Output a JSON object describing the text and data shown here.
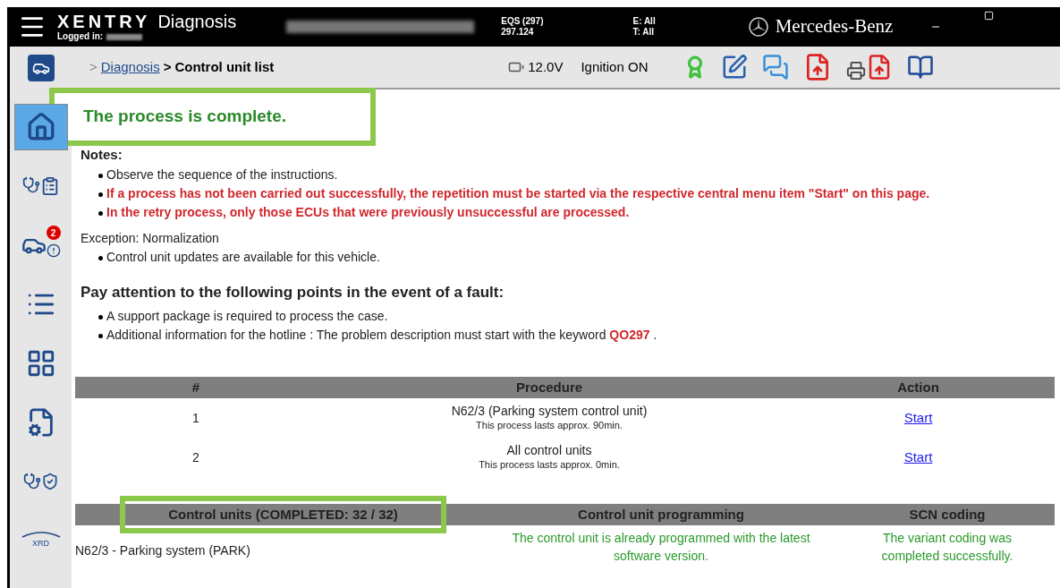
{
  "header": {
    "app_name": "XENTRY",
    "app_subtitle": "Diagnosis",
    "logged_in_label": "Logged in:",
    "vehicle_model": "EQS (297)",
    "vehicle_code": "297.124",
    "filter_e": "E: All",
    "filter_t": "T: All",
    "brand": "Mercedes-Benz"
  },
  "breadcrumb": {
    "separator": ">",
    "items": [
      "Diagnosis",
      "Control unit list"
    ],
    "voltage": "12.0V",
    "ignition": "Ignition ON"
  },
  "sidebar": {
    "items": [
      {
        "kind": "home",
        "selected": true
      },
      {
        "kind": "stethoscope-doc",
        "selected": false
      },
      {
        "kind": "car-alert",
        "selected": false,
        "badge": "2"
      },
      {
        "kind": "list",
        "selected": false
      },
      {
        "kind": "modules",
        "selected": false
      },
      {
        "kind": "doc-wrench",
        "selected": false
      },
      {
        "kind": "stethoscope-lock",
        "selected": false
      },
      {
        "kind": "xrd",
        "selected": false,
        "label": "XRD"
      }
    ]
  },
  "status": "The process is complete.",
  "notes": {
    "title": "Notes:",
    "items": [
      {
        "kind": "normal",
        "text": "Observe the sequence of the instructions."
      },
      {
        "kind": "warning",
        "text": "If a process has not been carried out successfully, the repetition must be started via the respective central menu item \"Start\" on this page."
      },
      {
        "kind": "warning",
        "text": "In the retry process, only those ECUs that were previously unsuccessful are processed."
      }
    ]
  },
  "exception": {
    "title": "Exception: Normalization",
    "items": [
      "Control unit updates are available for this vehicle."
    ]
  },
  "fault": {
    "title": "Pay attention to the following points in the event of a fault:",
    "items": [
      {
        "text": "A support package is required to process the case."
      },
      {
        "text": "Additional information for the hotline : The problem description must start with the keyword ",
        "keyword": "QO297",
        "suffix": " ."
      }
    ]
  },
  "procedures": {
    "columns": [
      "#",
      "Procedure",
      "Action"
    ],
    "rows": [
      {
        "number": "1",
        "name": "N62/3 (Parking system control unit)",
        "duration": "This process lasts approx. 90min.",
        "action": "Start"
      },
      {
        "number": "2",
        "name": "All control units",
        "duration": "This process lasts approx. 0min.",
        "action": "Start"
      }
    ]
  },
  "control_units": {
    "columns": [
      "Control units (COMPLETED: 32 / 32)",
      "Control unit programming",
      "SCN coding"
    ],
    "rows": [
      {
        "name": "N62/3 - Parking system (PARK)",
        "programming": "The control unit is already programmed with the latest software version.",
        "coding": "The variant coding was completed successfully."
      }
    ]
  }
}
